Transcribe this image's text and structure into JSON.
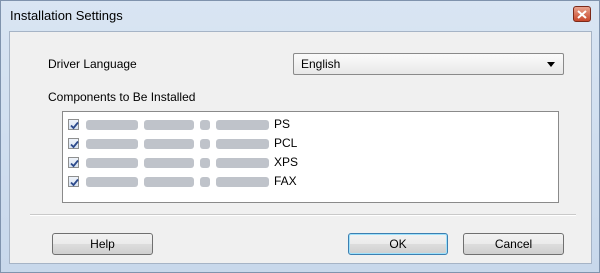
{
  "window": {
    "title": "Installation Settings"
  },
  "form": {
    "language_label": "Driver Language",
    "language_value": "English",
    "components_label": "Components to Be Installed"
  },
  "components": [
    {
      "suffix": "PS",
      "checked": true
    },
    {
      "suffix": "PCL",
      "checked": true
    },
    {
      "suffix": "XPS",
      "checked": true
    },
    {
      "suffix": "FAX",
      "checked": true
    }
  ],
  "buttons": {
    "help": "Help",
    "ok": "OK",
    "cancel": "Cancel"
  },
  "icons": {
    "close": "close-icon",
    "dropdown": "chevron-down-icon",
    "checkbox": "checkmark-icon"
  }
}
